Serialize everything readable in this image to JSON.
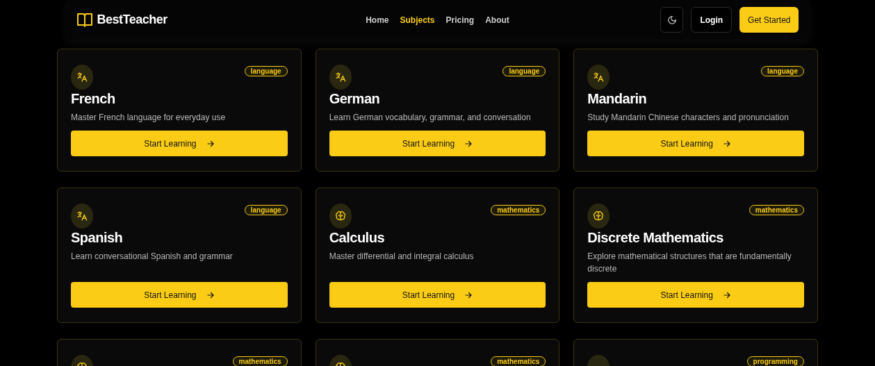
{
  "header": {
    "brand": "BestTeacher",
    "nav": [
      {
        "label": "Home",
        "selected": false
      },
      {
        "label": "Subjects",
        "selected": true
      },
      {
        "label": "Pricing",
        "selected": false
      },
      {
        "label": "About",
        "selected": false
      }
    ],
    "login": "Login",
    "cta": "Get Started"
  },
  "cards": [
    {
      "kind": "translate",
      "tag": "language",
      "title": "French",
      "description": "Master French language for everyday use",
      "button": "Start Learning"
    },
    {
      "kind": "translate",
      "tag": "language",
      "title": "German",
      "description": "Learn German vocabulary, grammar, and conversation",
      "button": "Start Learning"
    },
    {
      "kind": "translate",
      "tag": "language",
      "title": "Mandarin",
      "description": "Study Mandarin Chinese characters and pronunciation",
      "button": "Start Learning"
    },
    {
      "kind": "translate",
      "tag": "language",
      "title": "Spanish",
      "description": "Learn conversational Spanish and grammar",
      "button": "Start Learning"
    },
    {
      "kind": "brain",
      "tag": "mathematics",
      "title": "Calculus",
      "description": "Master differential and integral calculus",
      "button": "Start Learning"
    },
    {
      "kind": "brain",
      "tag": "mathematics",
      "title": "Discrete Mathematics",
      "description": "Explore mathematical structures that are fundamentally discrete",
      "button": "Start Learning"
    },
    {
      "kind": "brain",
      "tag": "mathematics"
    },
    {
      "kind": "brain",
      "tag": "mathematics"
    },
    {
      "tag": "programming"
    }
  ]
}
